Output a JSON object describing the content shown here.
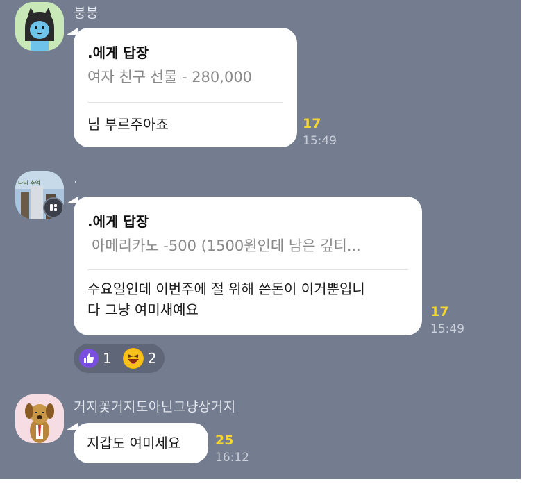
{
  "messages": [
    {
      "sender": "붕붕",
      "reply_to": ".에게 답장",
      "quote": "여자 친구 선물 - 280,000",
      "text_lines": [
        "님 부르주아죠"
      ],
      "unread": "17",
      "time": "15:49"
    },
    {
      "sender": ".",
      "reply_to": ".에게 답장",
      "quote": "아메리카노 -500 (1500원인데 남은 깊티...",
      "text_lines": [
        "수요일인데 이번주에 절 위해 쓴돈이 이거뿐입니",
        "다 그냥 여미새예요"
      ],
      "unread": "17",
      "time": "15:49",
      "reactions": [
        {
          "icon": "thumbs-up-icon",
          "count": "1"
        },
        {
          "icon": "grinning-face-icon",
          "count": "2"
        }
      ]
    },
    {
      "sender": "거지꽃거지도아닌그냥상거지",
      "text_lines": [
        "지갑도 여미세요"
      ],
      "unread": "25",
      "time": "16:12"
    }
  ],
  "avatar_overlay_label": "나의 추억",
  "colors": {
    "chat_background": "#747d8f",
    "bubble": "#ffffff",
    "unread_count": "#f5d531",
    "reaction_like": "#7a4fe0"
  }
}
